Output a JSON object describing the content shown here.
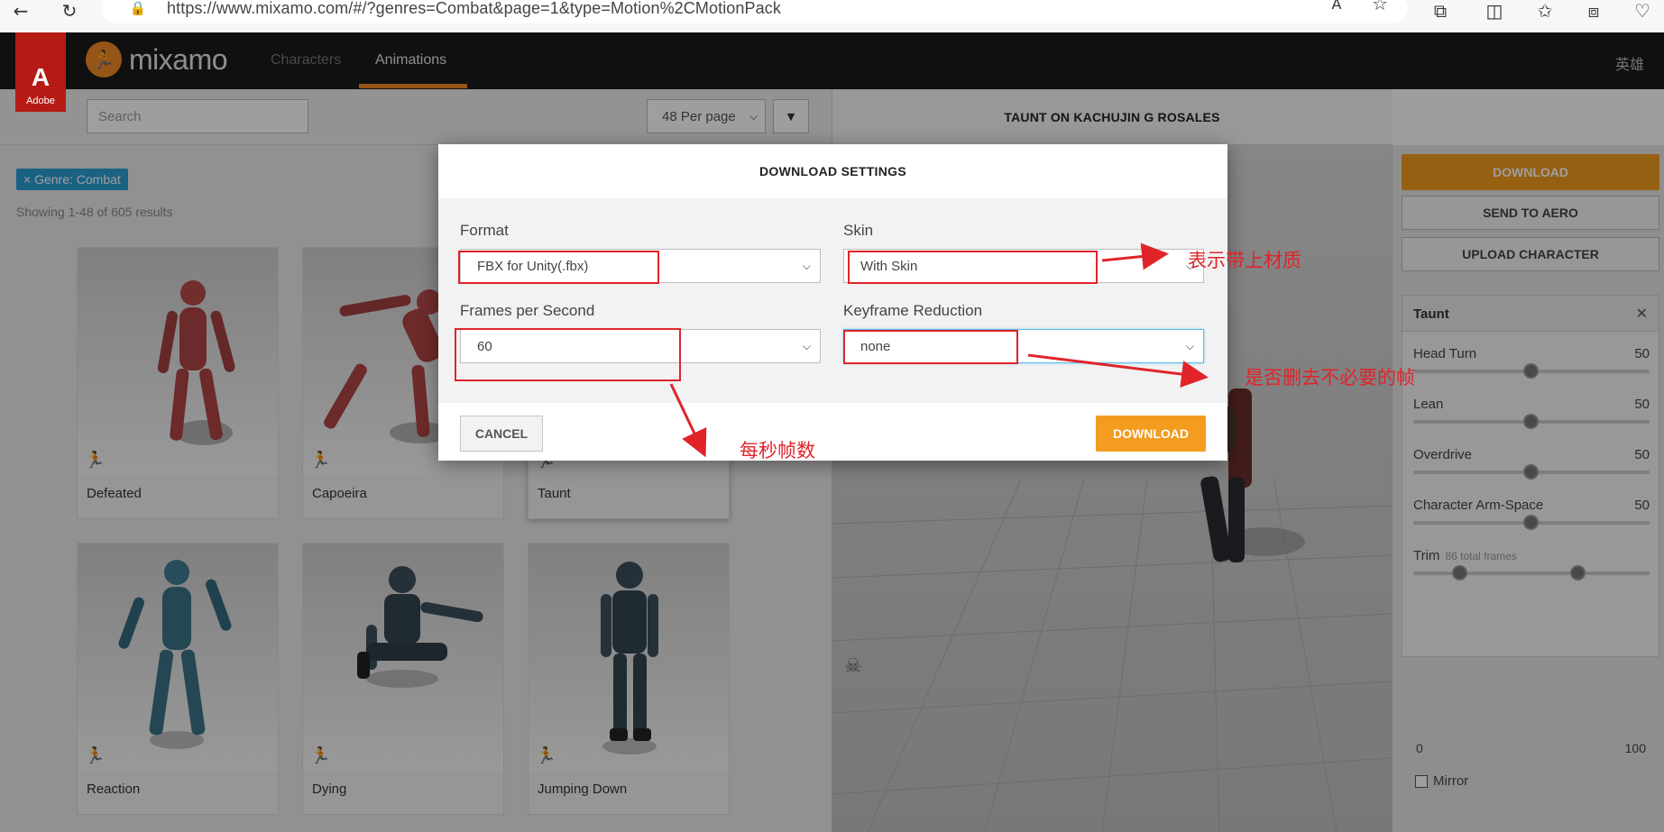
{
  "browser": {
    "url": "https://www.mixamo.com/#/?genres=Combat&page=1&type=Motion%2CMotionPack"
  },
  "header": {
    "adobe_label": "Adobe",
    "logo_text": "mixamo",
    "nav": {
      "characters": "Characters",
      "animations": "Animations"
    },
    "language": "英雄"
  },
  "toolbar": {
    "search_placeholder": "Search",
    "per_page": "48 Per page"
  },
  "filter": {
    "tag": "× Genre: Combat",
    "results": "Showing 1-48 of 605 results"
  },
  "cards": [
    {
      "label": "Defeated"
    },
    {
      "label": "Capoeira"
    },
    {
      "label": "Taunt"
    },
    {
      "label": "Reaction"
    },
    {
      "label": "Dying"
    },
    {
      "label": "Jumping Down"
    }
  ],
  "viewer": {
    "title": "TAUNT ON KACHUJIN G ROSALES"
  },
  "side": {
    "download": "DOWNLOAD",
    "send_to_aero": "SEND TO AERO",
    "upload_character": "UPLOAD CHARACTER",
    "panel_title": "Taunt",
    "params": [
      {
        "name": "Head Turn",
        "value": "50",
        "level": 0.5
      },
      {
        "name": "Lean",
        "value": "50",
        "level": 0.5
      },
      {
        "name": "Overdrive",
        "value": "50",
        "level": 0.5
      },
      {
        "name": "Character Arm-Space",
        "value": "50",
        "level": 0.5
      }
    ],
    "trim": {
      "label": "Trim",
      "sub": "86 total frames",
      "min": "0",
      "max": "100",
      "start": 0.2,
      "end": 0.7
    },
    "mirror": "Mirror"
  },
  "modal": {
    "title": "DOWNLOAD SETTINGS",
    "format_label": "Format",
    "format_value": "FBX for Unity(.fbx)",
    "skin_label": "Skin",
    "skin_value": "With Skin",
    "fps_label": "Frames per Second",
    "fps_value": "60",
    "keyframe_label": "Keyframe Reduction",
    "keyframe_value": "none",
    "cancel": "CANCEL",
    "download": "DOWNLOAD"
  },
  "annotations": {
    "skin_note": "表示带上材质",
    "keyframe_note": "是否删去不必要的帧",
    "fps_note": "每秒帧数"
  },
  "colors": {
    "accent": "#f39c1f",
    "annotation": "#e0242a",
    "tag": "#2a9fd6"
  }
}
